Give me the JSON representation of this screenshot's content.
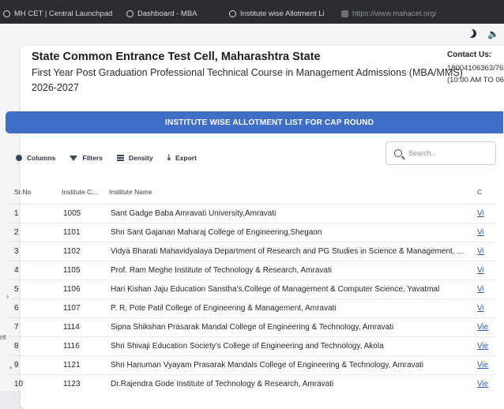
{
  "browser": {
    "tabs": [
      {
        "label": "MH CET | Central Launchpad"
      },
      {
        "label": "Dashboard - MBA"
      },
      {
        "label": "Institute wise Allotment List..."
      },
      {
        "label": "https://www.mahacet.org/..."
      }
    ]
  },
  "header": {
    "title": "State Common Entrance Test Cell, Maharashtra State",
    "subtitle": "First Year Post Graduation Professional Technical Course in Management Admissions (MBA/MMS)",
    "year": "2026-2027"
  },
  "contact": {
    "heading": "Contact Us:",
    "phone": "18004106363/76",
    "hours": "(10:00 AM TO 06:"
  },
  "banner": {
    "text": "INSTITUTE WISE ALLOTMENT LIST FOR CAP ROUND"
  },
  "toolbar": {
    "columns": "Columns",
    "filters": "Filters",
    "density": "Density",
    "export": "Export"
  },
  "search": {
    "placeholder": "Search..."
  },
  "table": {
    "headers": {
      "sr_no": "Sr.No",
      "code": "Institute C...",
      "name": "Institute Name",
      "action": "C"
    },
    "rows": [
      {
        "sr": "1",
        "code": "1005",
        "name": "Sant Gadge Baba Amravati University,Amravati",
        "action": "Vi"
      },
      {
        "sr": "2",
        "code": "1101",
        "name": "Shri Sant Gajanan Maharaj College of Engineering,Shegaon",
        "action": "Vi"
      },
      {
        "sr": "3",
        "code": "1102",
        "name": "Vidya Bharati Mahavidyalaya Department of Research and PG Studies in Science & Management, A...",
        "action": "Vi"
      },
      {
        "sr": "4",
        "code": "1105",
        "name": "Prof. Ram Meghe Institute of Technology & Research, Amravati",
        "action": "Vi"
      },
      {
        "sr": "5",
        "code": "1106",
        "name": "Hari Kishan Jaju Education Sanstha's,College of Management & Computer Science, Yavatmal",
        "action": "Vi"
      },
      {
        "sr": "6",
        "code": "1107",
        "name": "P. R. Pote Patil College of Engineering & Management, Amravati",
        "action": "Vi"
      },
      {
        "sr": "7",
        "code": "1114",
        "name": "Sipna Shikshan Prasarak Mandal College of Engineering & Technology, Amravati",
        "action": "Vie"
      },
      {
        "sr": "8",
        "code": "1116",
        "name": "Shri Shivaji Education Society's College of Engineering and Technology, Akola",
        "action": "Vie"
      },
      {
        "sr": "9",
        "code": "1121",
        "name": "Shri Hanuman Vyayam Prasarak Mandals College of Engineering & Technology, Amravati",
        "action": "Vie"
      },
      {
        "sr": "10",
        "code": "1123",
        "name": "Dr.Rajendra Gode Institute of Technology & Research, Amravati",
        "action": "Vie"
      }
    ]
  },
  "left_edge": {
    "text": "nt"
  }
}
